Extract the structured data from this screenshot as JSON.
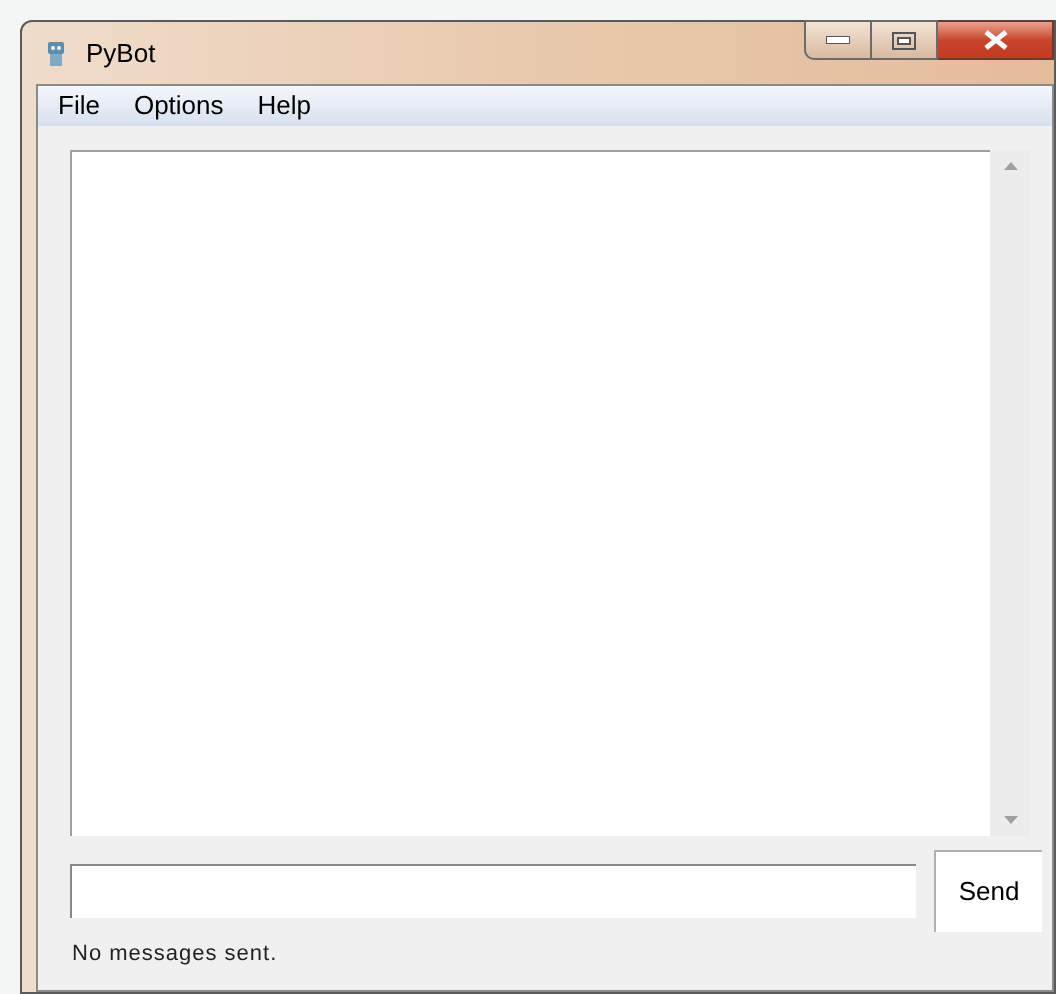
{
  "window": {
    "title": "PyBot"
  },
  "menu": [
    "File",
    "Options",
    "Help"
  ],
  "send_button": "Send",
  "status_bar": "No messages sent."
}
